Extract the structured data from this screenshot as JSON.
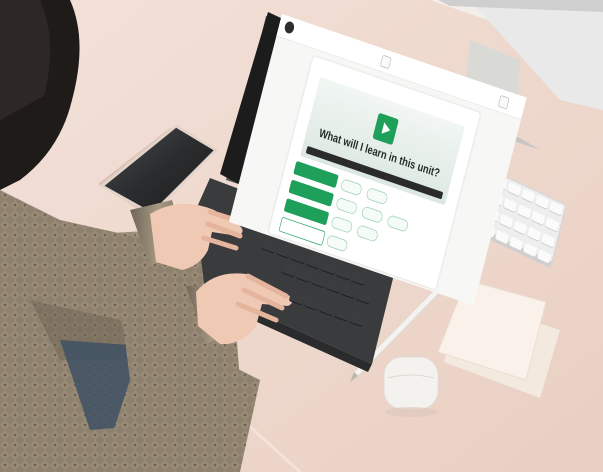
{
  "scene": {
    "description_colors": {
      "desk": "#efd8cd",
      "wall": "#f6f2ee",
      "sweater": "#8a7e6c",
      "keyboard_case": "#3a3b3d",
      "tablet_bezel": "#1c1c1c",
      "accent_green": "#1fa05a"
    }
  },
  "screen": {
    "app_title": "",
    "instruction": "",
    "video_caption": "What will I learn in this unit?",
    "choices": [
      {
        "label": ""
      },
      {
        "label": ""
      },
      {
        "label": ""
      },
      {
        "label": ""
      }
    ]
  }
}
